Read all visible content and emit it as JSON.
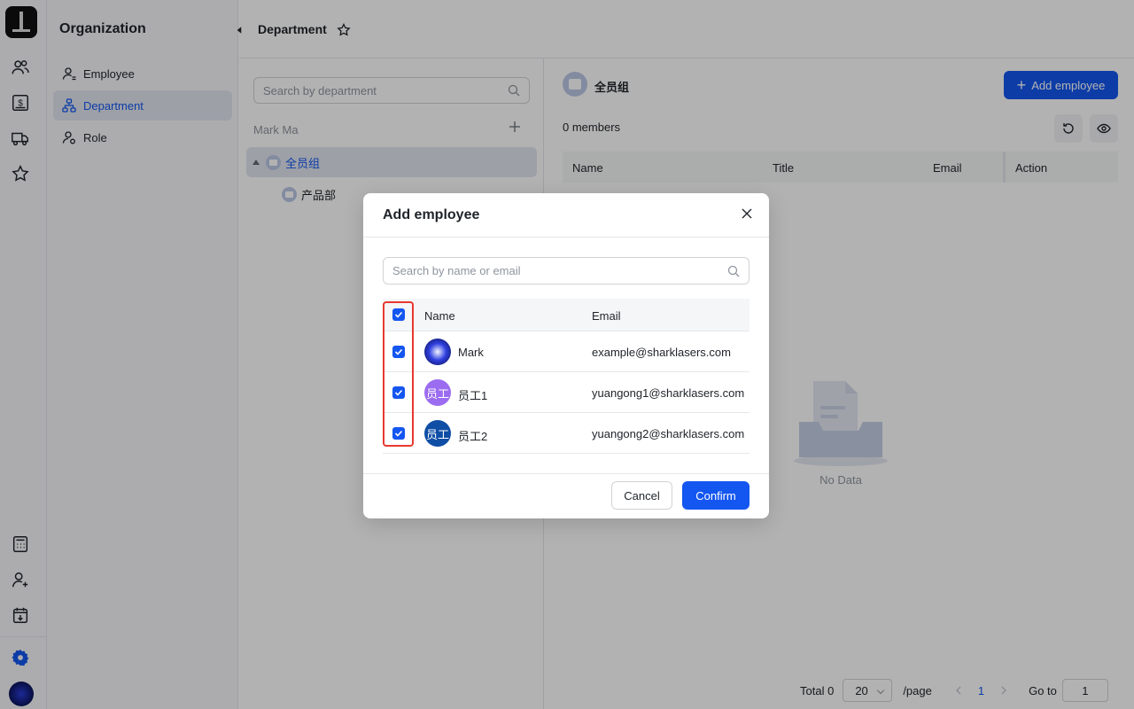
{
  "rail": {
    "icons": [
      "team-icon",
      "billing-icon",
      "truck-icon",
      "star-icon",
      "calculator-icon",
      "user-add-icon",
      "calendar-icon",
      "settings-icon"
    ],
    "accent": "#1456f0"
  },
  "sidebar": {
    "title": "Organization",
    "items": [
      {
        "label": "Employee",
        "icon": "user-icon"
      },
      {
        "label": "Department",
        "icon": "org-tree-icon",
        "active": true
      },
      {
        "label": "Role",
        "icon": "role-icon"
      }
    ]
  },
  "header": {
    "title": "Department"
  },
  "tree": {
    "search_placeholder": "Search by department",
    "owner": "Mark Ma",
    "nodes": [
      {
        "label": "全员组",
        "selected": true,
        "expanded": true
      },
      {
        "label": "产品部"
      }
    ]
  },
  "main": {
    "group_name": "全员组",
    "add_button": "Add employee",
    "members": "0 members",
    "columns": [
      "Name",
      "Title",
      "Email",
      "Action"
    ],
    "empty": "No Data",
    "pager": {
      "total": "Total 0",
      "page_size": "20",
      "per_page": "/page",
      "current": "1",
      "goto_label": "Go to",
      "goto_value": "1"
    }
  },
  "modal": {
    "title": "Add employee",
    "search_placeholder": "Search by name or email",
    "columns": [
      "Name",
      "Email"
    ],
    "rows": [
      {
        "name": "Mark",
        "email": "example@sharklasers.com",
        "avatar": "",
        "avatar_color": "#1a2ab8"
      },
      {
        "name": "员工1",
        "email": "yuangong1@sharklasers.com",
        "avatar": "员工",
        "avatar_color": "#9b6cf0"
      },
      {
        "name": "员工2",
        "email": "yuangong2@sharklasers.com",
        "avatar": "员工",
        "avatar_color": "#0f4ea5"
      }
    ],
    "all_checked": true,
    "cancel": "Cancel",
    "confirm": "Confirm"
  }
}
